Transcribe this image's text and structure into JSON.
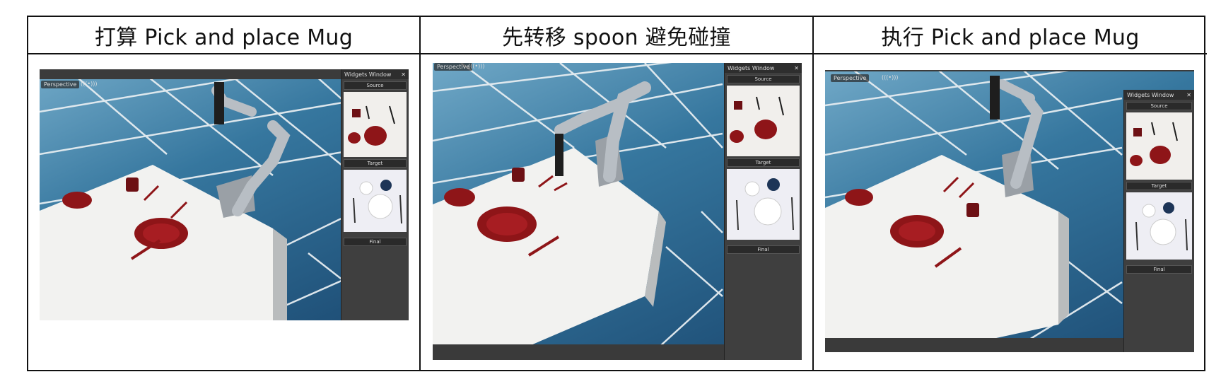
{
  "columns": [
    {
      "title": "打算 Pick and place Mug",
      "viewport_label": "Perspective",
      "viewport_icon": "(((•)))",
      "widgets_title": "Widgets Window",
      "source_label": "Source",
      "target_label": "Target",
      "final_label": "Final"
    },
    {
      "title": "先转移 spoon 避免碰撞",
      "viewport_label": "Perspective",
      "viewport_icon": "(((•)))",
      "widgets_title": "Widgets Window",
      "source_label": "Source",
      "target_label": "Target",
      "final_label": "Final"
    },
    {
      "title": "执行 Pick and place Mug",
      "viewport_label": "Perspective",
      "viewport_icon": "(((•)))",
      "widgets_title": "Widgets Window",
      "source_label": "Source",
      "target_label": "Target",
      "final_label": "Final"
    }
  ],
  "colors": {
    "tile_grout": "#e8eef2",
    "table_white": "#f2f2f0",
    "table_side": "#b9bcbd",
    "plate_red": "#8e1518",
    "robot_grey": "#b8bec4",
    "gripper_black": "#1e1e1e",
    "panel_dark": "#3f3f3f"
  }
}
